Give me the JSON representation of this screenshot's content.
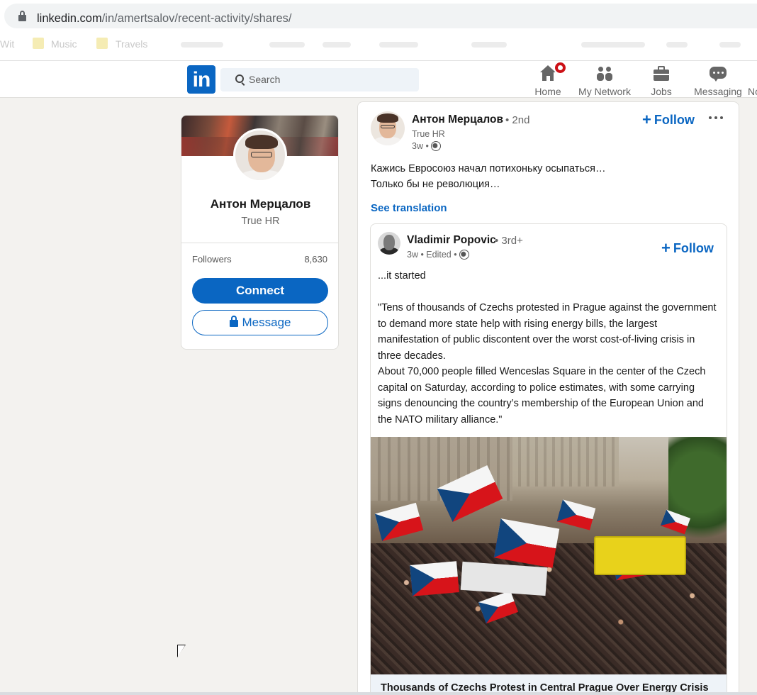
{
  "browser": {
    "url_host": "linkedin.com",
    "url_path": "/in/amertsalov/recent-activity/shares/",
    "bookmarks": [
      "Wit",
      "Music",
      "Travels"
    ]
  },
  "nav": {
    "logo": "in",
    "search_placeholder": "Search",
    "items": [
      {
        "label": "Home"
      },
      {
        "label": "My Network"
      },
      {
        "label": "Jobs"
      },
      {
        "label": "Messaging"
      },
      {
        "label": "No"
      }
    ]
  },
  "profile": {
    "name": "Антон Мерцалов",
    "headline": "True HR",
    "followers_label": "Followers",
    "followers_count": "8,630",
    "connect_label": "Connect",
    "message_label": "Message"
  },
  "post": {
    "author": "Антон Мерцалов",
    "degree": "• 2nd",
    "headline": "True HR",
    "time": "3w •",
    "follow_label": "Follow",
    "text_line1": "Кажись Евросоюз начал потихоньку осыпаться…",
    "text_line2": "Только бы не революция…",
    "see_translation": "See translation",
    "shared": {
      "author": "Vladimir Popovic",
      "degree": "• 3rd+",
      "meta": "3w • Edited •",
      "follow_label": "Follow",
      "text_intro": "...it started",
      "text_quote1": "\"Tens of thousands of Czechs protested in Prague against the government to demand more state help with rising energy bills, the largest manifestation of public discontent over the worst cost-of-living crisis in three decades.",
      "text_quote2": "About 70,000 people filled Wenceslas Square in the center of the Czech capital on Saturday, according to police estimates, with some carrying signs denouncing the country’s membership of the European Union and the NATO military alliance.\"",
      "link_title": "Thousands of Czechs Protest in Central Prague Over Energy Crisis"
    }
  },
  "colors": {
    "brand": "#0a66c2",
    "background": "#f3f2ef",
    "notification": "#cc1016"
  },
  "icons": [
    "lock-icon",
    "search-icon",
    "home-icon",
    "network-icon",
    "jobs-icon",
    "messaging-icon",
    "globe-icon",
    "more-icon",
    "plus-icon"
  ]
}
